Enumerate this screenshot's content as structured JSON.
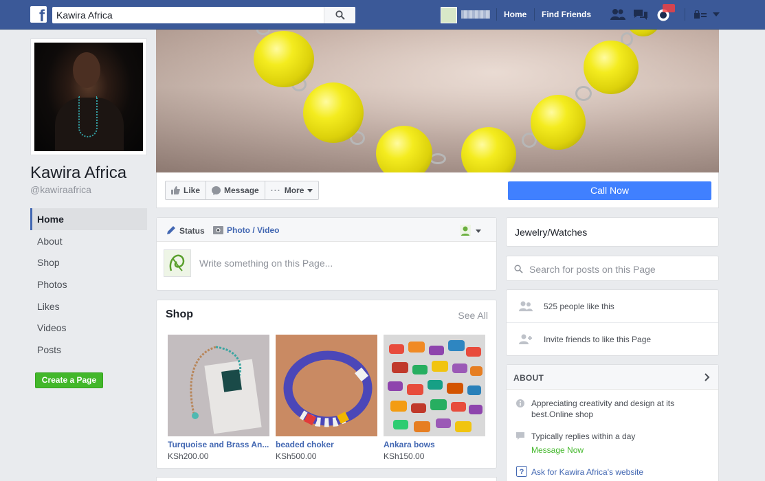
{
  "topbar": {
    "search_value": "Kawira Africa",
    "nav": {
      "home": "Home",
      "find_friends": "Find Friends"
    }
  },
  "page": {
    "name": "Kawira Africa",
    "handle": "@kawiraafrica"
  },
  "left_nav": {
    "items": [
      "Home",
      "About",
      "Shop",
      "Photos",
      "Likes",
      "Videos",
      "Posts"
    ],
    "active": "Home"
  },
  "create_page_label": "Create a Page",
  "actions": {
    "like": "Like",
    "message": "Message",
    "more": "More",
    "call_now": "Call Now"
  },
  "composer": {
    "status_tab": "Status",
    "photo_tab": "Photo / Video",
    "placeholder": "Write something on this Page..."
  },
  "shop": {
    "title": "Shop",
    "see_all": "See All",
    "products": [
      {
        "name": "Turquoise and Brass An...",
        "price": "KSh200.00"
      },
      {
        "name": "beaded choker",
        "price": "KSh500.00"
      },
      {
        "name": "Ankara bows",
        "price": "KSh150.00"
      }
    ]
  },
  "sidebar": {
    "category": "Jewelry/Watches",
    "search_placeholder": "Search for posts on this Page",
    "likes_count": "525 people like this",
    "invite": "Invite friends to like this Page",
    "about_header": "ABOUT",
    "about_description": "Appreciating creativity and design at its best.Online shop",
    "replies": "Typically replies within a day",
    "message_now": "Message Now",
    "ask_website": "Ask for Kawira Africa's website"
  },
  "colors": {
    "brand": "#3b5998",
    "accent": "#4080ff",
    "green": "#42b72a"
  }
}
